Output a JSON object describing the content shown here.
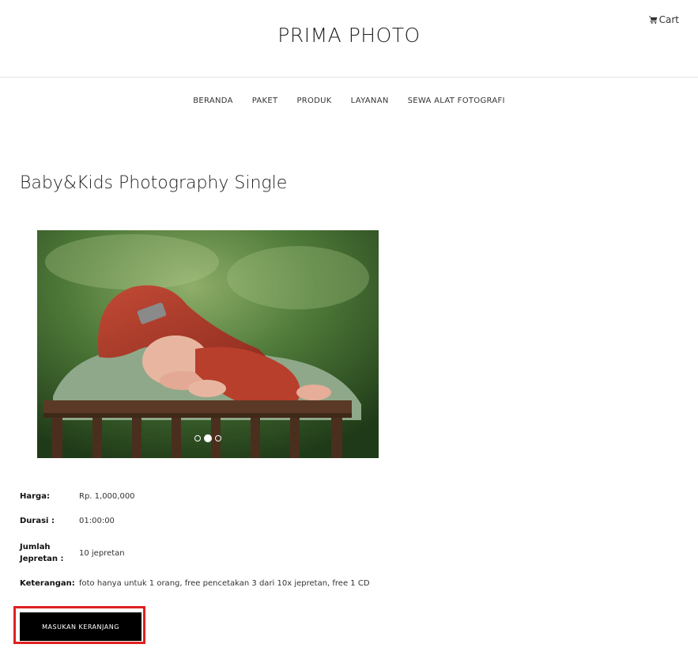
{
  "header": {
    "site_title": "PRIMA PHOTO",
    "cart_label": "Cart",
    "cart_icon": "shopping-cart-icon"
  },
  "nav": {
    "items": [
      "BERANDA",
      "PAKET",
      "PRODUK",
      "LAYANAN",
      "SEWA ALAT FOTOGRAFI"
    ]
  },
  "product": {
    "title": "Baby&Kids Photography Single",
    "carousel": {
      "slide_count": 3,
      "active_slide": 2
    },
    "details": [
      {
        "label": "Harga:",
        "value": "Rp. 1,000,000"
      },
      {
        "label": "Durasi :",
        "value": "01:00:00"
      },
      {
        "label": "Jumlah Jepretan :",
        "value": "10 jepretan"
      },
      {
        "label": "Keterangan:",
        "value": "foto hanya untuk 1 orang, free pencetakan 3 dari 10x jepretan, free 1 CD"
      }
    ],
    "add_to_cart_label": "MASUKAN KERANJANG"
  },
  "colors": {
    "highlight_frame": "#e02020",
    "button_bg": "#000000"
  }
}
